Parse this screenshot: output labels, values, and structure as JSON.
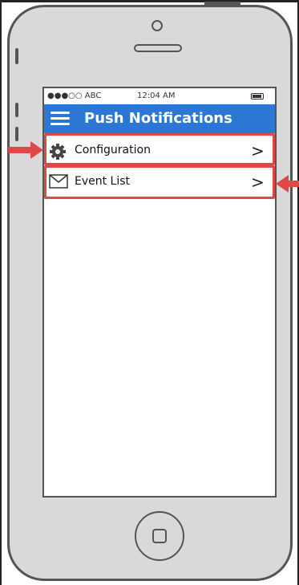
{
  "status_bar": {
    "carrier": "●●●○○ ABC",
    "time": "12:04 AM"
  },
  "navbar": {
    "title": "Push Notifications"
  },
  "menu": [
    {
      "label": "Configuration",
      "icon": "gear-icon"
    },
    {
      "label": "Event List",
      "icon": "envelope-icon"
    }
  ],
  "colors": {
    "accent": "#2b77d3",
    "highlight": "#e04848"
  }
}
